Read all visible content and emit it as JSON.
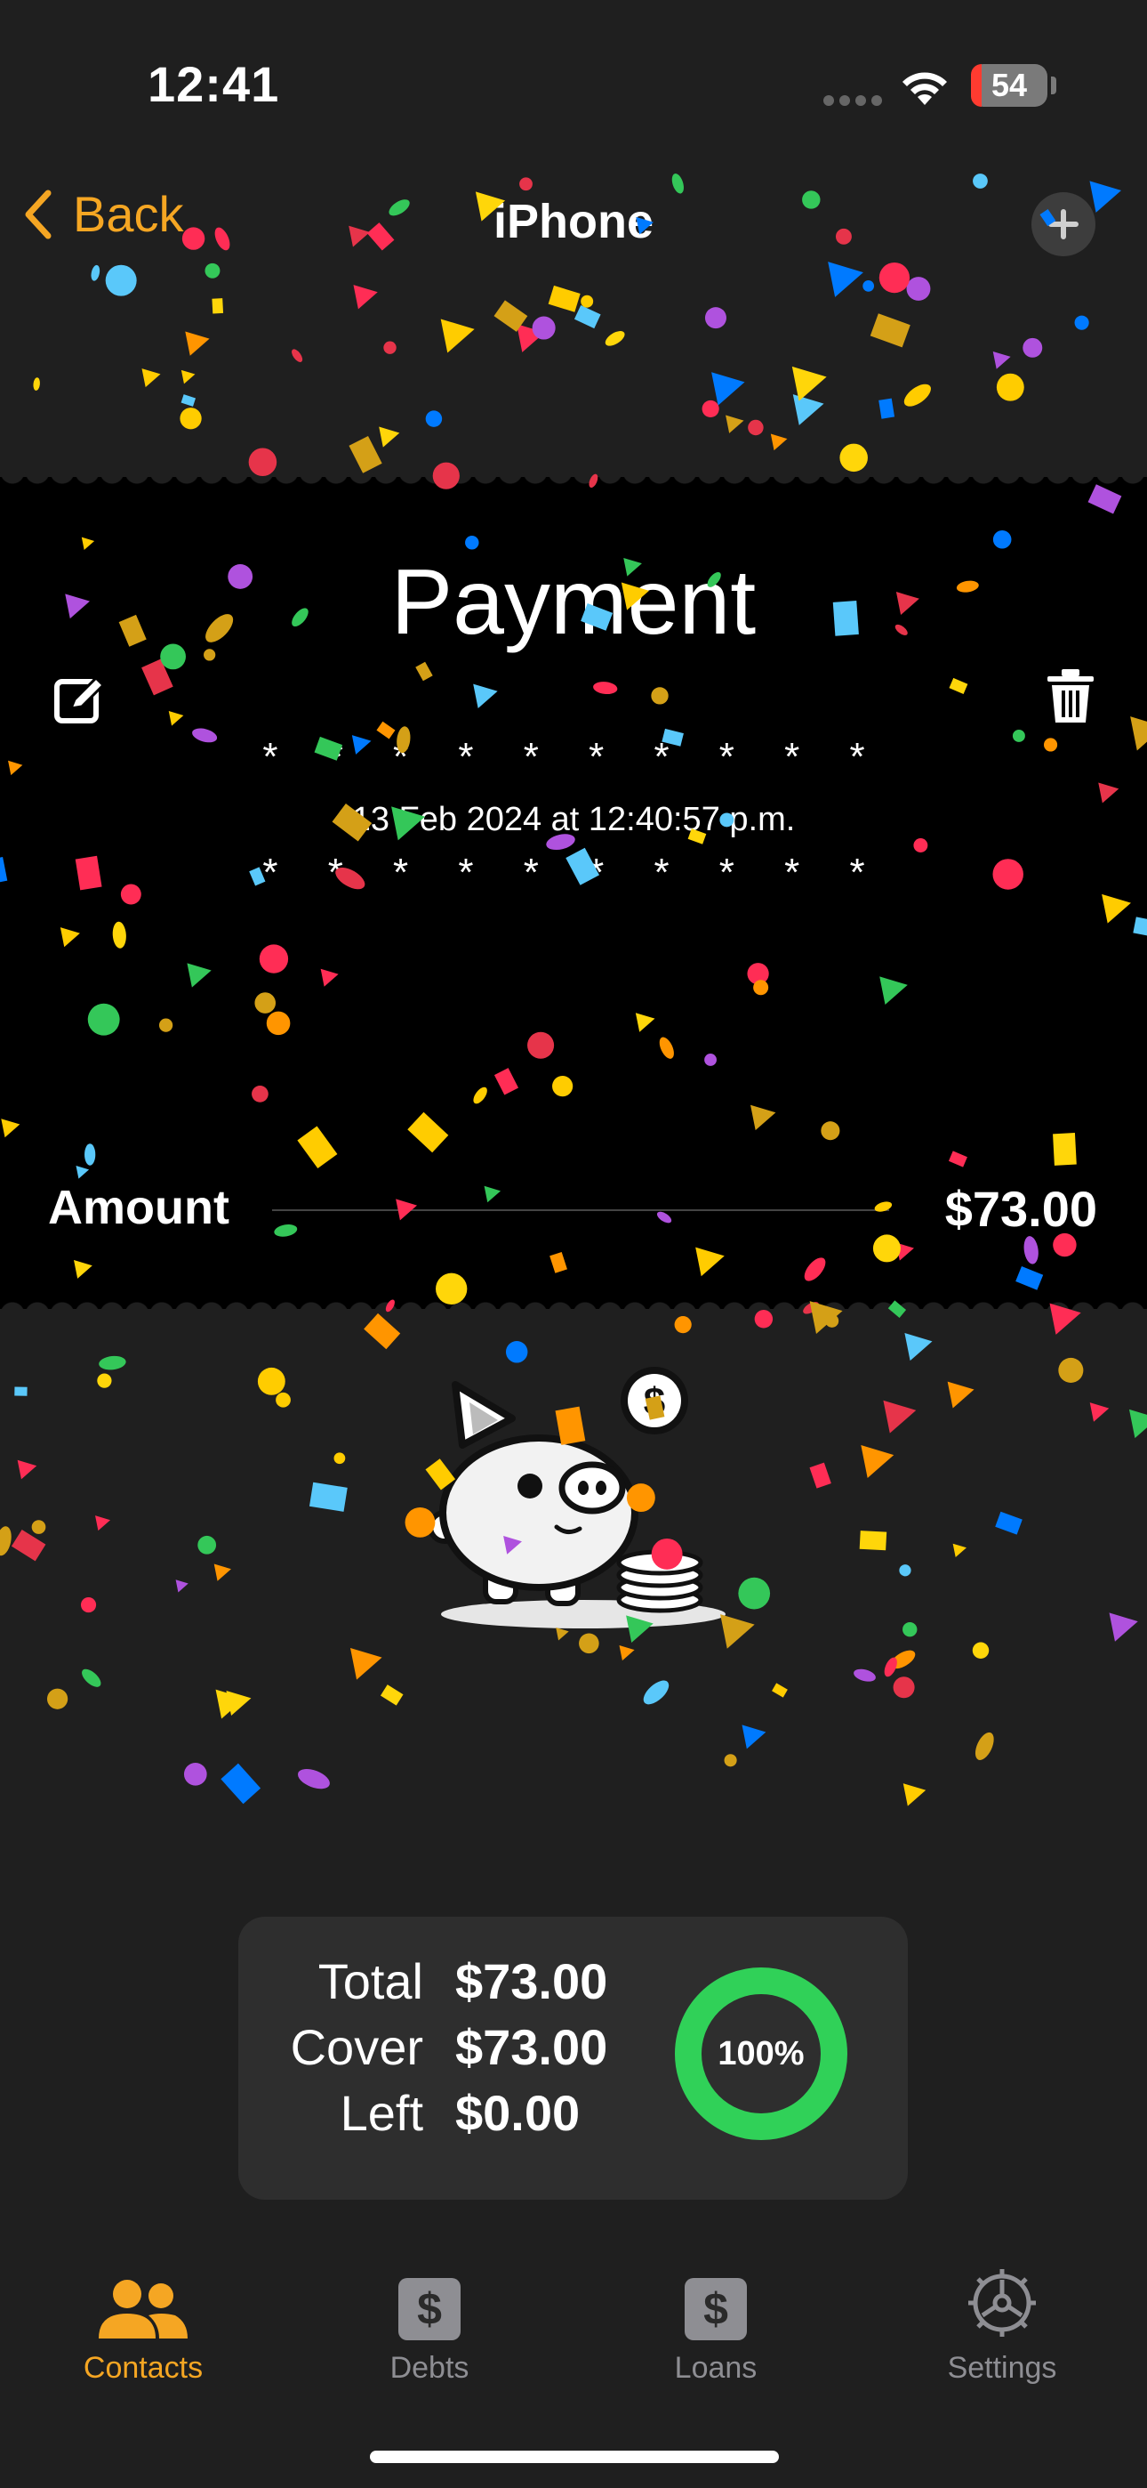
{
  "status_bar": {
    "time": "12:41",
    "battery": "54"
  },
  "nav": {
    "back_label": "Back",
    "title": "iPhone"
  },
  "ticket": {
    "title": "Payment",
    "stars": "* * * * * * * * * *",
    "date": "13 Feb 2024 at 12:40:57 p.m.",
    "amount_label": "Amount",
    "amount_value": "$73.00"
  },
  "summary": {
    "total_label": "Total",
    "total_value": "$73.00",
    "cover_label": "Cover",
    "cover_value": "$73.00",
    "left_label": "Left",
    "left_value": "$0.00",
    "progress_text": "100%",
    "progress_fraction": 1.0
  },
  "tabs": [
    {
      "label": "Contacts",
      "icon": "contacts-icon",
      "active": true
    },
    {
      "label": "Debts",
      "icon": "dollar-icon",
      "active": false
    },
    {
      "label": "Loans",
      "icon": "dollar-icon",
      "active": false
    },
    {
      "label": "Settings",
      "icon": "gear-icon",
      "active": false
    }
  ],
  "colors": {
    "accent": "#f5a623",
    "progress": "#30d158",
    "background": "#1f1f1f",
    "ticket": "#000000"
  }
}
